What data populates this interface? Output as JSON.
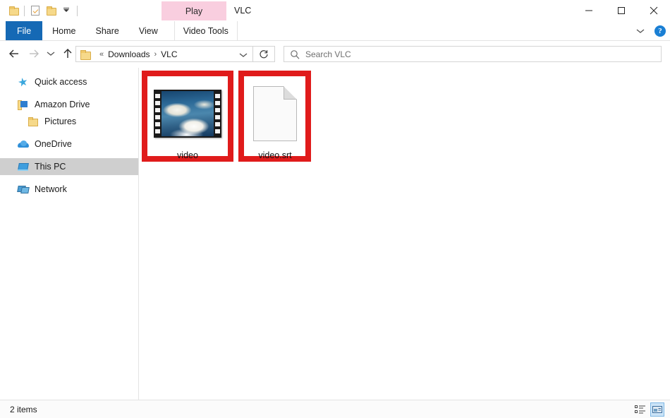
{
  "window": {
    "title": "VLC",
    "controls": {
      "minimize": "—",
      "maximize": "☐",
      "close": "✕"
    }
  },
  "quick_access_toolbar": {
    "items": [
      {
        "name": "properties-icon",
        "label": "Properties"
      },
      {
        "name": "new-folder-icon",
        "label": "New folder"
      },
      {
        "name": "customize-caret-icon",
        "label": "Customize Quick Access Toolbar"
      }
    ]
  },
  "ribbon": {
    "contextual_group": "Play",
    "contextual_label": "Video Tools",
    "tabs": [
      {
        "id": "file",
        "label": "File"
      },
      {
        "id": "home",
        "label": "Home"
      },
      {
        "id": "share",
        "label": "Share"
      },
      {
        "id": "view",
        "label": "View"
      }
    ],
    "collapse_label": "⌄",
    "help_label": "?",
    "file_tab_color": "#1569b5",
    "contextual_color": "#f9cedf"
  },
  "address_bar": {
    "back_label": "←",
    "forward_label": "→",
    "recent_label": "⌄",
    "up_label": "↑",
    "breadcrumb_overflow": "«",
    "breadcrumb": [
      "Downloads",
      "VLC"
    ],
    "separator": "›",
    "dropdown_label": "⌄",
    "refresh_label": "↻"
  },
  "search": {
    "placeholder": "Search VLC",
    "icon": "search-icon"
  },
  "sidebar": {
    "items": [
      {
        "id": "quick-access",
        "label": "Quick access",
        "icon": "star-icon",
        "indent": false,
        "selected": false
      },
      {
        "id": "amazon-drive",
        "label": "Amazon Drive",
        "icon": "amazon-drive-icon",
        "indent": false,
        "selected": false
      },
      {
        "id": "pictures",
        "label": "Pictures",
        "icon": "folder-icon",
        "indent": true,
        "selected": false
      },
      {
        "id": "onedrive",
        "label": "OneDrive",
        "icon": "cloud-icon",
        "indent": false,
        "selected": false
      },
      {
        "id": "this-pc",
        "label": "This PC",
        "icon": "computer-icon",
        "indent": false,
        "selected": true
      },
      {
        "id": "network",
        "label": "Network",
        "icon": "network-icon",
        "indent": false,
        "selected": false
      }
    ]
  },
  "files": [
    {
      "id": "video",
      "label": "video",
      "icon": "video-thumbnail",
      "highlighted": true
    },
    {
      "id": "video-srt",
      "label": "video.srt",
      "icon": "blank-document-icon",
      "highlighted": true
    }
  ],
  "annotations": {
    "color": "#e01b1b",
    "boxes": [
      "video",
      "video.srt"
    ]
  },
  "status_bar": {
    "item_count": "2 items",
    "views": [
      {
        "id": "details",
        "label": "Details view",
        "active": false
      },
      {
        "id": "large-icons",
        "label": "Large icons view",
        "active": true
      }
    ]
  }
}
